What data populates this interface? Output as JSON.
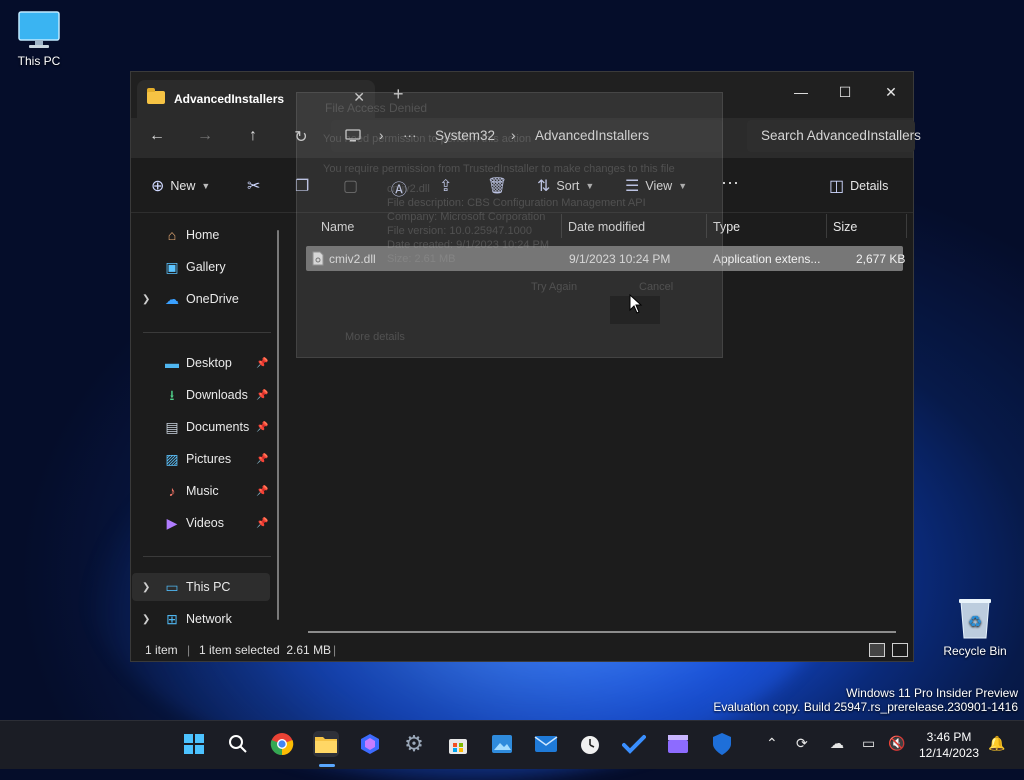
{
  "desktop": {
    "icons": {
      "this_pc": "This PC",
      "recycle_bin": "Recycle Bin"
    },
    "watermark": {
      "line1": "Windows 11 Pro Insider Preview",
      "line2": "Evaluation copy. Build 25947.rs_prerelease.230901-1416"
    }
  },
  "explorer": {
    "tab": {
      "title": "AdvancedInstallers",
      "close": "✕",
      "new_tab": "+"
    },
    "caption": {
      "minimize": "—",
      "maximize": "☐",
      "close": "✕"
    },
    "nav": {
      "back": "←",
      "forward": "→",
      "up": "↑",
      "refresh": "↻"
    },
    "address": {
      "more": "···",
      "segments": [
        "System32",
        "AdvancedInstallers"
      ],
      "separator": "›"
    },
    "search": {
      "placeholder": "Search AdvancedInstallers"
    },
    "toolbar": {
      "new_label": "New",
      "sort_label": "Sort",
      "view_label": "View",
      "more": "···",
      "details_label": "Details"
    },
    "sidebar": {
      "home": "Home",
      "gallery": "Gallery",
      "onedrive": "OneDrive",
      "desktop": "Desktop",
      "downloads": "Downloads",
      "documents": "Documents",
      "pictures": "Pictures",
      "music": "Music",
      "videos": "Videos",
      "this_pc": "This PC",
      "network": "Network"
    },
    "columns": {
      "name": "Name",
      "date": "Date modified",
      "type": "Type",
      "size": "Size"
    },
    "files": [
      {
        "name": "cmiv2.dll",
        "date": "9/1/2023 10:24 PM",
        "type": "Application extens...",
        "size": "2,677 KB"
      }
    ],
    "status": {
      "count": "1 item",
      "selected": "1 item selected  2.61 MB"
    }
  },
  "ghost_dialog": {
    "title": "File Access Denied",
    "line1": "You need permission to perform this action",
    "line2": "You require permission from TrustedInstaller to make changes to this file",
    "line3": "cmiv2.dll",
    "line4": "File description: CBS Configuration Management API",
    "line5": "Company: Microsoft Corporation",
    "line6": "File version: 10.0.25947.1000",
    "line7": "Date created: 9/1/2023 10:24 PM",
    "line8": "Size: 2.61 MB",
    "try_again": "Try Again",
    "cancel": "Cancel",
    "more_details": "More details"
  },
  "taskbar": {
    "clock": {
      "time": "3:46 PM",
      "date": "12/14/2023"
    }
  },
  "colors": {
    "accent": "#5aa7ff",
    "window_bg": "#1c1c1c",
    "selected_row": "#777777",
    "folder": "#f6c344"
  }
}
